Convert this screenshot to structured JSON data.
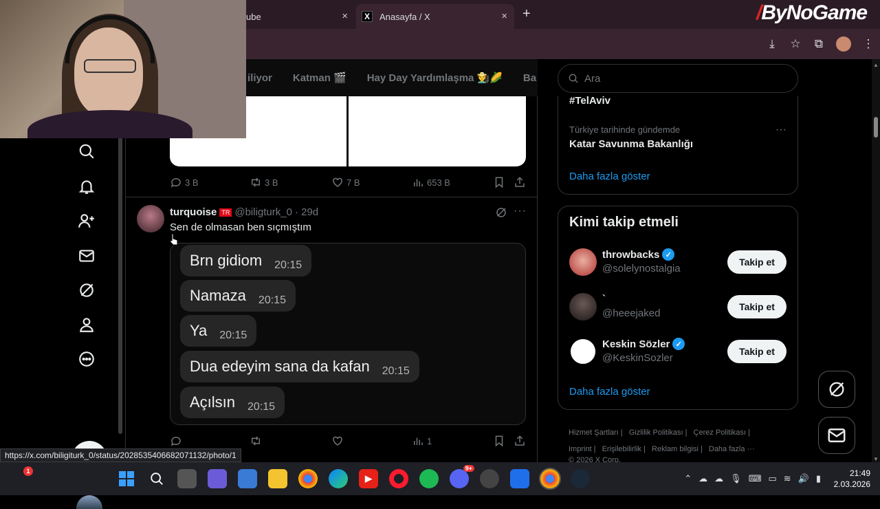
{
  "browser": {
    "tabs": [
      {
        "label": "ube",
        "close": "×"
      },
      {
        "label": "Anasayfa / X",
        "close": "×"
      }
    ],
    "newtab": "+",
    "brand": "ByNoGame",
    "status_url": "https://x.com/biligiturk_0/status/2028535406682071132/photo/1"
  },
  "topnav": {
    "tabs": [
      "iliyor",
      "Katman 🎬",
      "Hay Day Yardımlaşma 👨‍🌾🌽",
      "Ba"
    ]
  },
  "tweet1": {
    "replies": "3 B",
    "retweets": "3 B",
    "likes": "7 B",
    "views": "653 B"
  },
  "tweet2": {
    "name": "turquoise",
    "flag": "TR",
    "handle": "@biligturk_0",
    "time": "· 29d",
    "more": "···",
    "text": "Sen de olmasan ben sıçmıştım",
    "messages": [
      {
        "msg": "Brn  gidiom",
        "time": "20:15"
      },
      {
        "msg": "Namaza",
        "time": "20:15"
      },
      {
        "msg": "Ya",
        "time": "20:15"
      },
      {
        "msg": "Dua edeyim sana da kafan",
        "time": "20:15"
      },
      {
        "msg": "Açılsın",
        "time": "20:15"
      }
    ],
    "views": "1"
  },
  "search": {
    "placeholder": "Ara"
  },
  "trends": {
    "tag": "#TelAviv",
    "meta": "Türkiye tarihinde gündemde",
    "title": "Katar Savunma Bakanlığı",
    "more": "···",
    "show_more": "Daha fazla göster"
  },
  "who_to_follow": {
    "title": "Kimi takip etmeli",
    "accounts": [
      {
        "name": "throwbacks",
        "handle": "@solelynostalgia",
        "verified": true,
        "button": "Takip et"
      },
      {
        "name": "`",
        "handle": "@heeejaked",
        "verified": false,
        "button": "Takip et"
      },
      {
        "name": "Keskin Sözler",
        "handle": "@KeskinSozler",
        "verified": true,
        "button": "Takip et"
      }
    ],
    "show_more": "Daha fazla göster"
  },
  "footer": {
    "links": [
      "Hizmet Şartları |",
      "Gizlilik Politikası |",
      "Çerez Politikası |",
      "Imprint |",
      "Erişilebilirlik |",
      "Reklam bilgisi |",
      "Daha fazla ···",
      "© 2026 X Corp."
    ]
  },
  "taskbar": {
    "time": "21:49",
    "date": "2.03.2026",
    "badge": "1",
    "discord_badge": "9+"
  },
  "colors": {
    "accent": "#1d9bf0",
    "background": "#000000",
    "chrome": "#3a2430"
  }
}
